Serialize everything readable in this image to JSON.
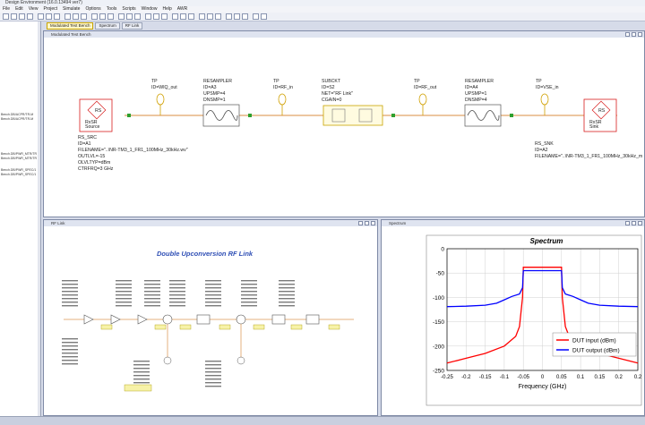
{
  "app": {
    "title": "Design Environment (16.0.13494 ver7)",
    "menu": [
      "File",
      "Edit",
      "View",
      "Project",
      "Simulate",
      "Options",
      "Tools",
      "Scripts",
      "Window",
      "Help",
      "AWR"
    ]
  },
  "tabs": [
    {
      "label": "Modulated Test Bench",
      "active": true
    },
    {
      "label": "Spectrum",
      "active": false
    },
    {
      "label": "RF Link",
      "active": false
    }
  ],
  "project_tree": [
    "Bench.DB/ACPR/TR-M",
    "Bench.DB/ACPR/TR-M",
    "Bench.DB/PWR_MTR/TR",
    "Bench.DB/PWR_MTR/TR",
    "Bench.DB/PWR_SPEC/1",
    "Bench.DB/PWR_SPEC/1"
  ],
  "windows": {
    "schematic_title": "Modulated Test Bench",
    "rflink_title": "RF Link",
    "spectrum_title": "Spectrum"
  },
  "schematic": {
    "source": {
      "label1": "RxSR",
      "label2": "Source",
      "name": "RS_SRC",
      "id": "ID=A1",
      "filename": "FILENAME=\"..\\NR-TM3_1_FR1_100MHz_30kHz.wv\"",
      "outlvl": "OUTLVL=-15",
      "outlvltyp": "OLVLTYP=dBm",
      "ctrfrq": "CTRFRQ=3 GHz"
    },
    "tp1": {
      "name": "TP",
      "id": "ID=WIQ_out"
    },
    "resampler1": {
      "name": "RESAMPLER",
      "id": "ID=A3",
      "upsmp": "UPSMP=4",
      "dnsmp": "DNSMP=1"
    },
    "tp2": {
      "name": "TP",
      "id": "ID=RF_in"
    },
    "subckt": {
      "name": "SUBCKT",
      "id": "ID=S2",
      "net": "NET=\"RF Link\"",
      "cgain": "CGAIN=0"
    },
    "tp3": {
      "name": "TP",
      "id": "ID=RF_out"
    },
    "resampler2": {
      "name": "RESAMPLER",
      "id": "ID=A4",
      "upsmp": "UPSMP=1",
      "dnsmp": "DNSMP=4"
    },
    "tp4": {
      "name": "TP",
      "id": "ID=VSE_in"
    },
    "sink": {
      "label1": "RxSR",
      "label2": "Sink",
      "name": "RS_SNK",
      "id": "ID=A2",
      "filename": "FILENAME=\"..\\NR-TM3_1_FR1_100MHz_30kHz_m"
    }
  },
  "rflink": {
    "title": "Double Upconversion RF Link"
  },
  "chart_data": {
    "type": "line",
    "title": "Spectrum",
    "xlabel": "Frequency (GHz)",
    "ylabel": "",
    "xlim": [
      -0.25,
      0.25
    ],
    "ylim": [
      -250,
      0
    ],
    "x_ticks": [
      "-0.25",
      "-0.2",
      "-0.15",
      "-0.1",
      "-0.05",
      "0",
      "0.05",
      "0.1",
      "0.15",
      "0.2",
      "0.2"
    ],
    "y_ticks": [
      "0",
      "-50",
      "-100",
      "-150",
      "-200",
      "-250"
    ],
    "grid": true,
    "legend_position": "bottom-right",
    "series": [
      {
        "name": "DUT input (dBm)",
        "color": "#ff0000",
        "x": [
          -0.25,
          -0.2,
          -0.15,
          -0.1,
          -0.07,
          -0.06,
          -0.052,
          -0.05,
          0.0,
          0.05,
          0.052,
          0.06,
          0.07,
          0.1,
          0.15,
          0.2,
          0.25
        ],
        "y": [
          -235,
          -225,
          -215,
          -200,
          -180,
          -160,
          -100,
          -38,
          -38,
          -38,
          -100,
          -160,
          -180,
          -200,
          -215,
          -225,
          -235
        ]
      },
      {
        "name": "DUT output (dBm)",
        "color": "#0000ff",
        "x": [
          -0.25,
          -0.2,
          -0.15,
          -0.12,
          -0.1,
          -0.08,
          -0.06,
          -0.052,
          -0.05,
          0.0,
          0.05,
          0.052,
          0.06,
          0.08,
          0.1,
          0.12,
          0.15,
          0.2,
          0.25
        ],
        "y": [
          -119,
          -118,
          -116,
          -112,
          -105,
          -98,
          -93,
          -80,
          -45,
          -45,
          -45,
          -80,
          -93,
          -98,
          -105,
          -112,
          -116,
          -118,
          -119
        ]
      }
    ]
  }
}
